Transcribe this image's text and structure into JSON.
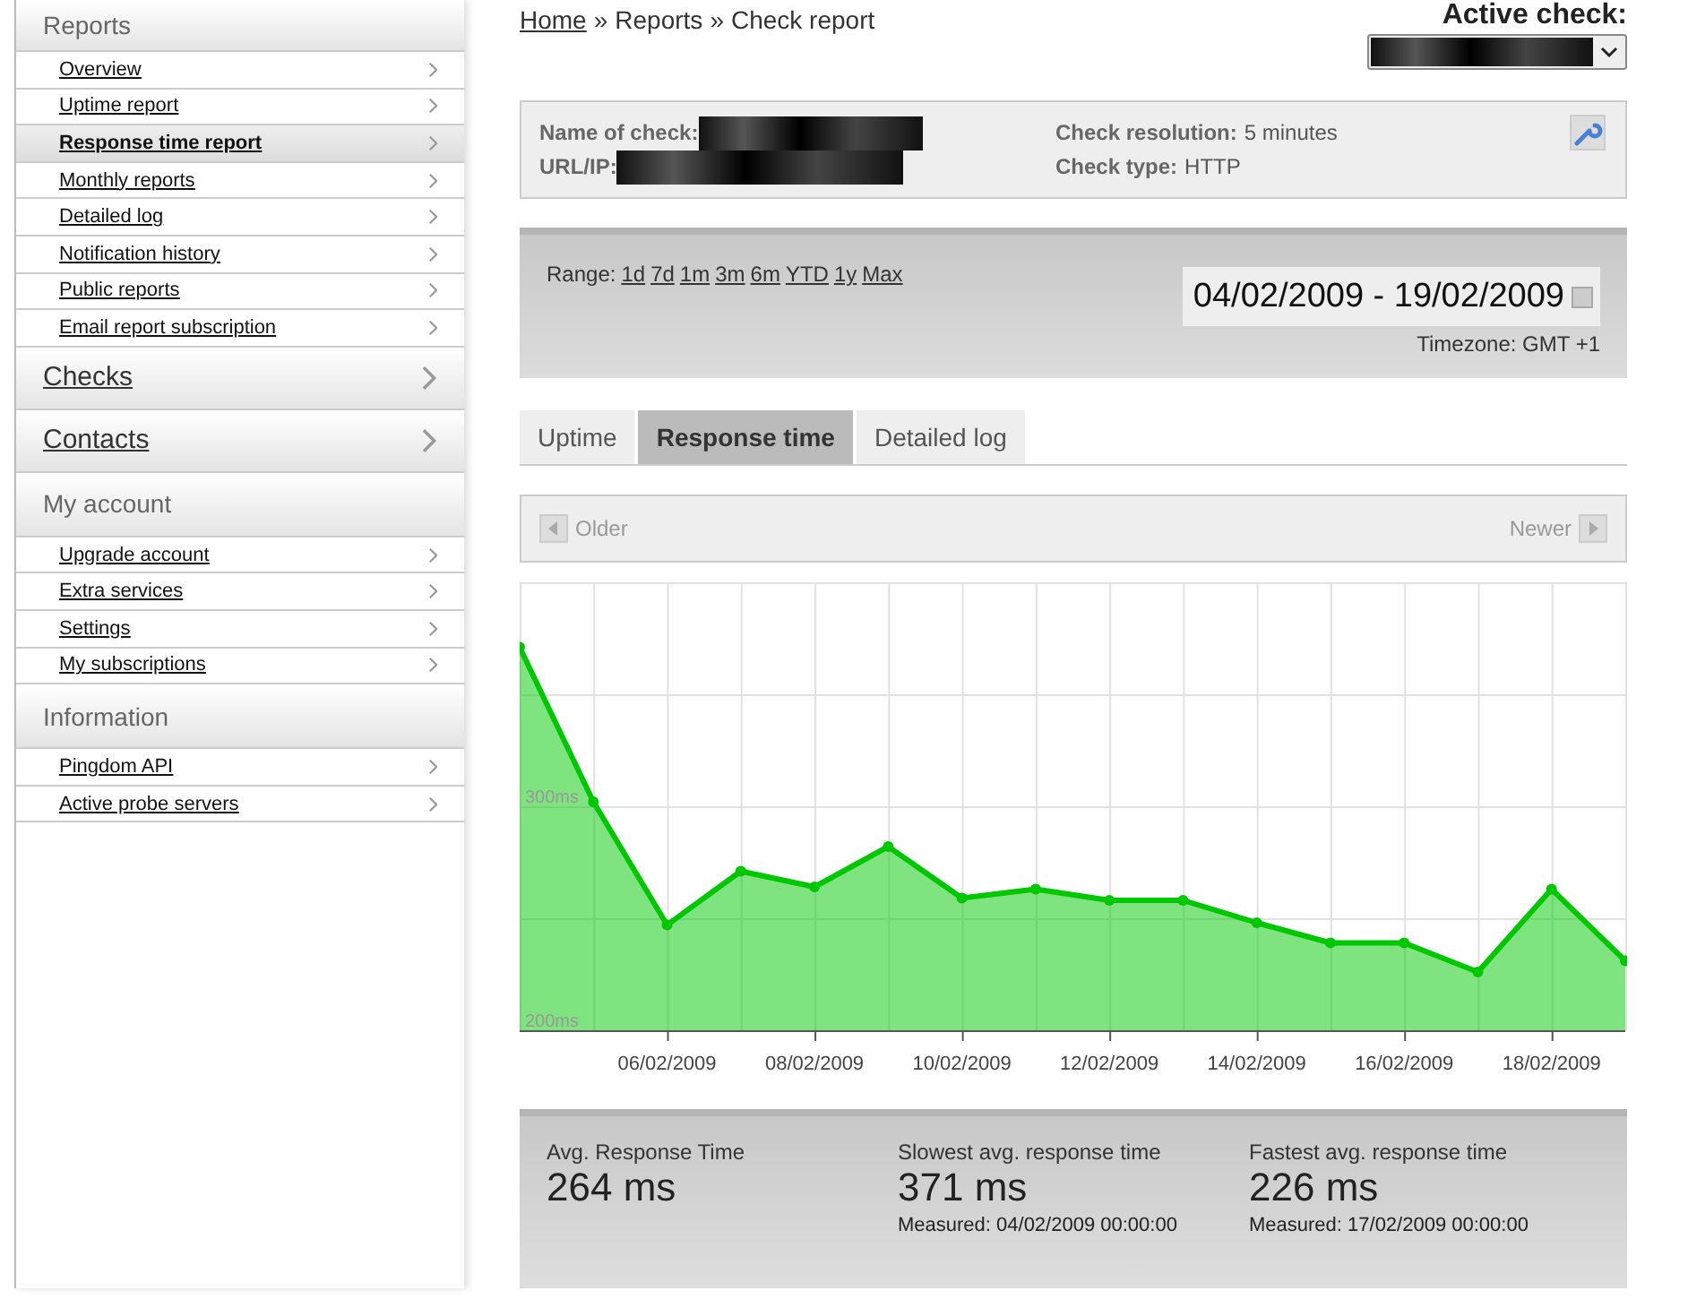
{
  "sidebar": {
    "sections": [
      {
        "title": "Reports",
        "kind": "group",
        "items": [
          {
            "label": "Overview",
            "selected": false
          },
          {
            "label": "Uptime report",
            "selected": false
          },
          {
            "label": "Response time report",
            "selected": true
          },
          {
            "label": "Monthly reports",
            "selected": false
          },
          {
            "label": "Detailed log",
            "selected": false
          },
          {
            "label": "Notification history",
            "selected": false
          },
          {
            "label": "Public reports",
            "selected": false
          },
          {
            "label": "Email report subscription",
            "selected": false
          }
        ]
      },
      {
        "title": "Checks",
        "kind": "link"
      },
      {
        "title": "Contacts",
        "kind": "link"
      },
      {
        "title": "My account",
        "kind": "group",
        "items": [
          {
            "label": "Upgrade account",
            "selected": false
          },
          {
            "label": "Extra services",
            "selected": false
          },
          {
            "label": "Settings",
            "selected": false
          },
          {
            "label": "My subscriptions",
            "selected": false
          }
        ]
      },
      {
        "title": "Information",
        "kind": "group",
        "items": [
          {
            "label": "Pingdom API",
            "selected": false
          },
          {
            "label": "Active probe servers",
            "selected": false
          }
        ]
      }
    ]
  },
  "breadcrumb": [
    {
      "label": "Home",
      "kind": "link"
    },
    {
      "label": "»",
      "kind": "separator"
    },
    {
      "label": "Reports",
      "kind": "text"
    },
    {
      "label": "»",
      "kind": "separator"
    },
    {
      "label": "Check report",
      "kind": "text"
    }
  ],
  "active_check": {
    "label": "Active check:"
  },
  "check_info": {
    "fields": [
      {
        "label": "Name of check:",
        "redacted": true
      },
      {
        "label": "URL/IP:",
        "redacted": true
      },
      {
        "label": "Check resolution:",
        "value": "5 minutes"
      },
      {
        "label": "Check type:",
        "value": "HTTP"
      }
    ]
  },
  "range": {
    "label": "Range:",
    "options": [
      "1d",
      "7d",
      "1m",
      "3m",
      "6m",
      "YTD",
      "1y",
      "Max"
    ],
    "dates": "04/02/2009 - 19/02/2009",
    "timezone": "Timezone: GMT +1"
  },
  "tabs": [
    {
      "label": "Uptime",
      "selected": false
    },
    {
      "label": "Response time",
      "selected": true
    },
    {
      "label": "Detailed log",
      "selected": false
    }
  ],
  "pager": {
    "older": "Older",
    "newer": "Newer"
  },
  "chart_data": {
    "type": "area",
    "categories": [
      null,
      null,
      "06/02/2009",
      null,
      "08/02/2009",
      null,
      "10/02/2009",
      null,
      "12/02/2009",
      null,
      "14/02/2009",
      null,
      "16/02/2009",
      null,
      "18/02/2009",
      null
    ],
    "series": [
      {
        "color": "#00c800",
        "values": [
          371,
          302,
          247,
          271,
          264,
          282,
          259,
          263,
          258,
          258,
          248,
          239,
          239,
          226,
          263,
          231
        ]
      }
    ],
    "ylim": [
      200,
      400
    ],
    "grid": true,
    "yticks": [
      {
        "value": 200,
        "label": "200ms"
      },
      {
        "value": 300,
        "label": "300ms"
      }
    ]
  },
  "stats": [
    {
      "label": "Avg. Response Time",
      "value": "264 ms"
    },
    {
      "label": "Slowest avg. response time",
      "value": "371 ms",
      "measured": "Measured: 04/02/2009 00:00:00"
    },
    {
      "label": "Fastest avg. response time",
      "value": "226 ms",
      "measured": "Measured: 17/02/2009 00:00:00"
    }
  ]
}
